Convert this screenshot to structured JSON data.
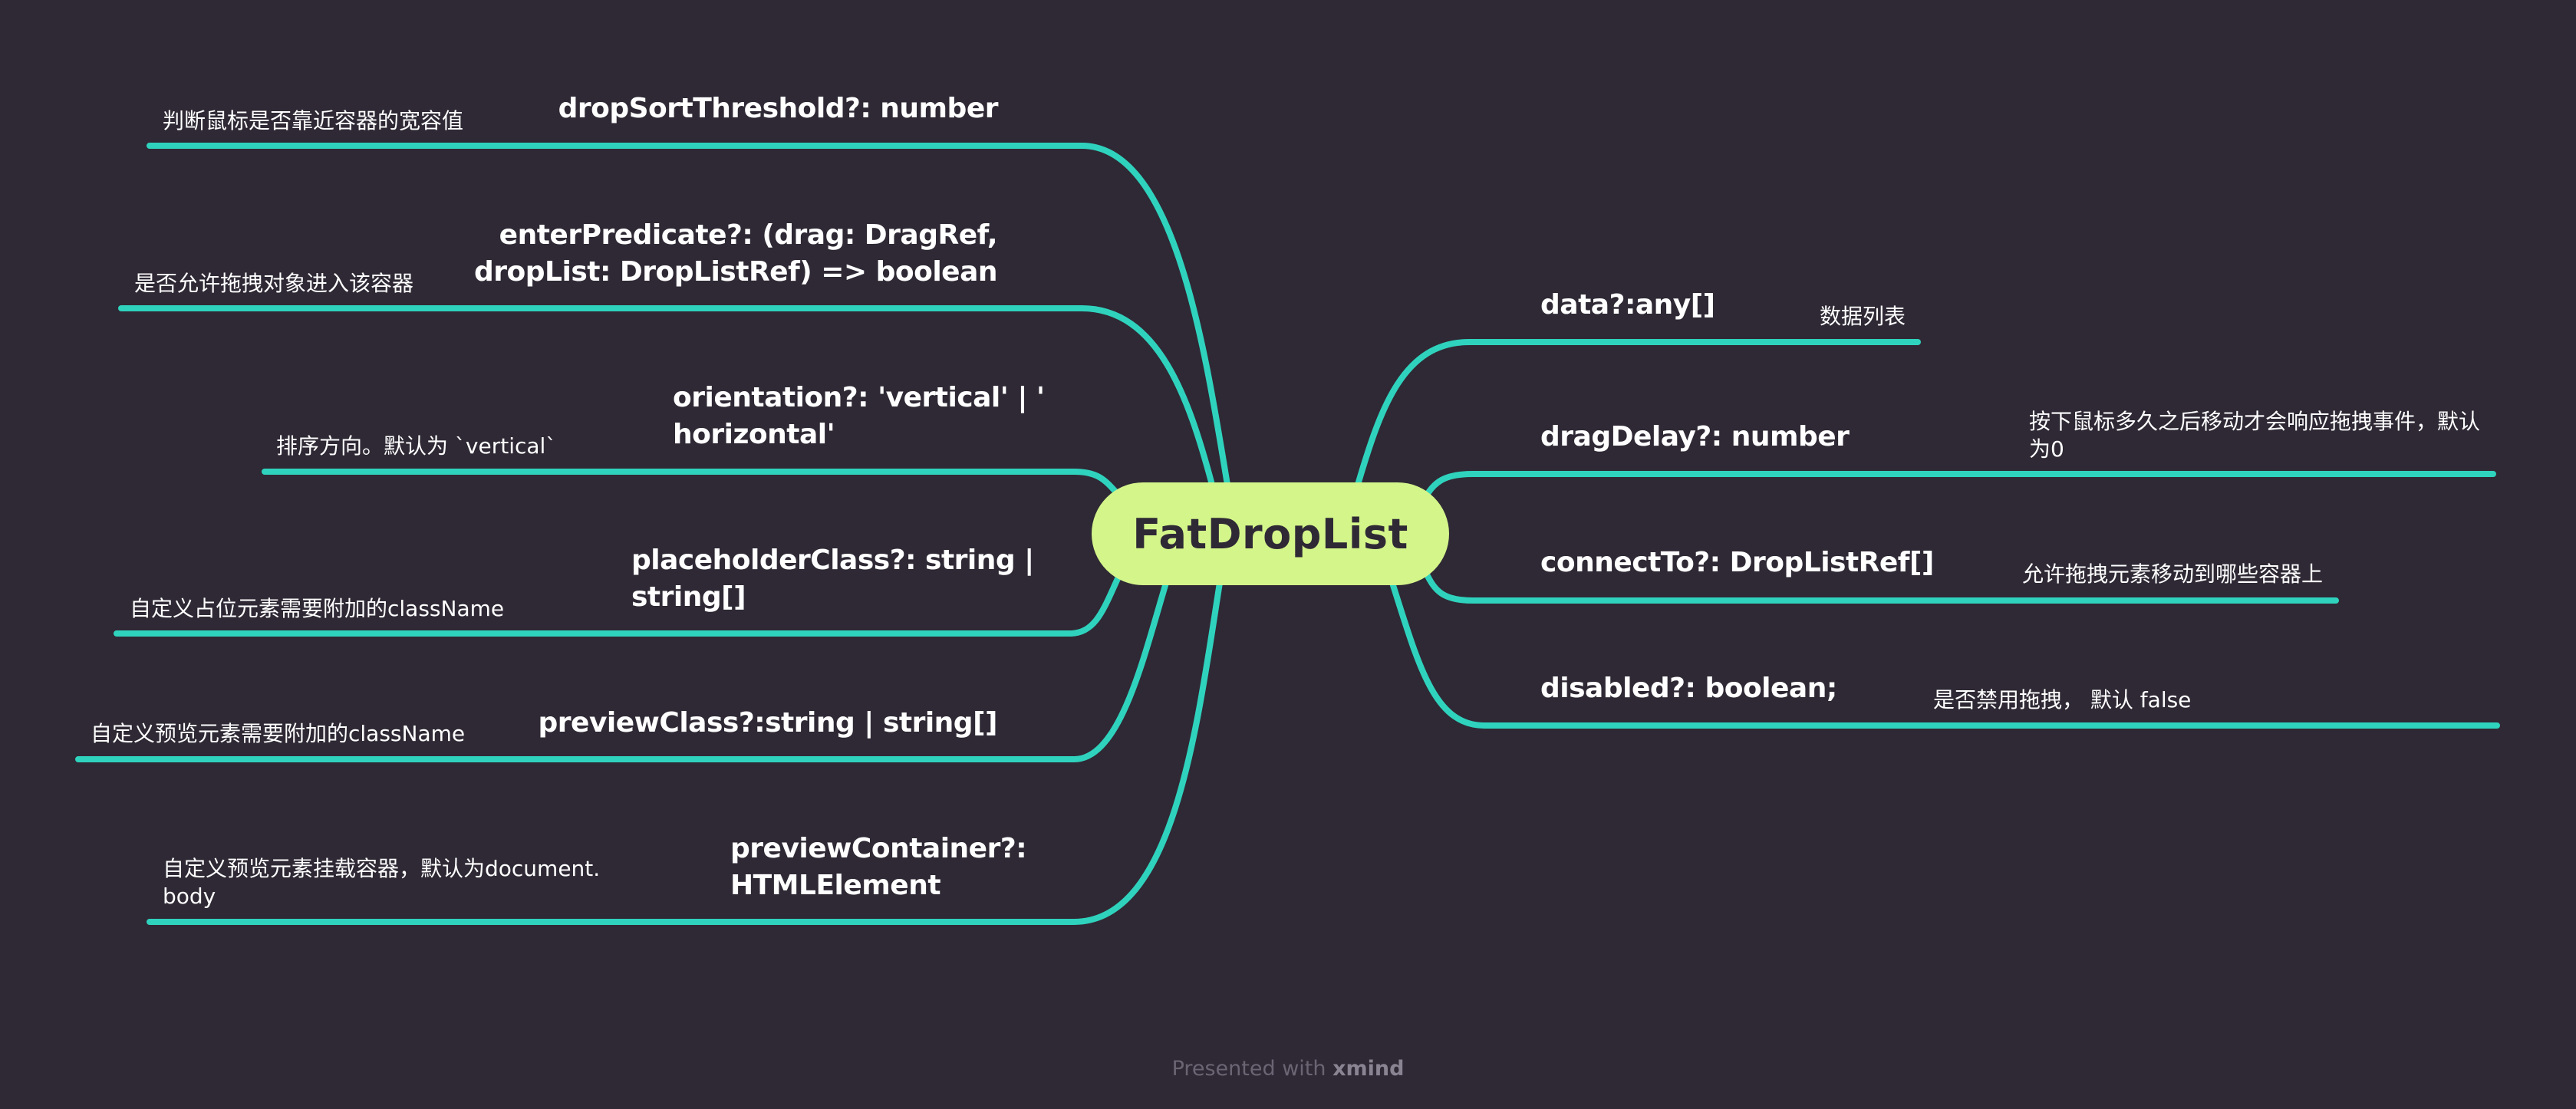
{
  "central": "FatDropList",
  "left": [
    {
      "topic": [
        "dropSortThreshold?: number"
      ],
      "note": [
        "判断鼠标是否靠近容器的宽容值"
      ]
    },
    {
      "topic": [
        "enterPredicate?: (drag: DragRef,",
        "dropList: DropListRef) => boolean"
      ],
      "note": [
        "是否允许拖拽对象进入该容器"
      ]
    },
    {
      "topic": [
        "orientation?: 'vertical' | '",
        "horizontal'"
      ],
      "note": [
        "排序方向。默认为 `vertical`"
      ]
    },
    {
      "topic": [
        "placeholderClass?: string |",
        "string[]"
      ],
      "note": [
        "自定义占位元素需要附加的className"
      ]
    },
    {
      "topic": [
        "previewClass?:string | string[]"
      ],
      "note": [
        "自定义预览元素需要附加的className"
      ]
    },
    {
      "topic": [
        "previewContainer?:",
        "HTMLElement"
      ],
      "note": [
        "自定义预览元素挂载容器，默认为document.",
        "body"
      ]
    }
  ],
  "right": [
    {
      "topic": [
        "data?:any[]"
      ],
      "note": [
        "数据列表"
      ]
    },
    {
      "topic": [
        "dragDelay?: number"
      ],
      "note": [
        "按下鼠标多久之后移动才会响应拖拽事件，默认",
        "为0"
      ]
    },
    {
      "topic": [
        "connectTo?: DropListRef[]"
      ],
      "note": [
        "允许拖拽元素移动到哪些容器上"
      ]
    },
    {
      "topic": [
        "disabled?: boolean;"
      ],
      "note": [
        "是否禁用拖拽， 默认 false"
      ]
    }
  ],
  "footer": {
    "prefix": "Presented with ",
    "brand": "xmind"
  },
  "colors": {
    "background": "#2f2935",
    "branch": "#2fd3bd",
    "central": "#d3f58a",
    "central_text": "#2f2935"
  }
}
